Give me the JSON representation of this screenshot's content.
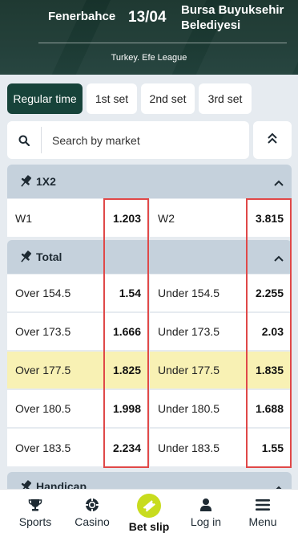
{
  "match": {
    "team1": "Fenerbahce",
    "score": "13/04",
    "team2": "Bursa Buyuksehir Belediyesi",
    "league": "Turkey. Efe League"
  },
  "tabs": [
    {
      "label": "Regular time",
      "active": true
    },
    {
      "label": "1st set",
      "active": false
    },
    {
      "label": "2nd set",
      "active": false
    },
    {
      "label": "3rd set",
      "active": false
    }
  ],
  "search": {
    "placeholder": "Search by market",
    "icon": "search-icon"
  },
  "collapse_icon": "double-chevron-up-icon",
  "markets": [
    {
      "title": "1X2",
      "rows": [
        {
          "left_label": "W1",
          "left_odd": "1.203",
          "right_label": "W2",
          "right_odd": "3.815",
          "highlighted": false
        }
      ]
    },
    {
      "title": "Total",
      "rows": [
        {
          "left_label": "Over 154.5",
          "left_odd": "1.54",
          "right_label": "Under 154.5",
          "right_odd": "2.255",
          "highlighted": false
        },
        {
          "left_label": "Over 173.5",
          "left_odd": "1.666",
          "right_label": "Under 173.5",
          "right_odd": "2.03",
          "highlighted": false
        },
        {
          "left_label": "Over 177.5",
          "left_odd": "1.825",
          "right_label": "Under 177.5",
          "right_odd": "1.835",
          "highlighted": true
        },
        {
          "left_label": "Over 180.5",
          "left_odd": "1.998",
          "right_label": "Under 180.5",
          "right_odd": "1.688",
          "highlighted": false
        },
        {
          "left_label": "Over 183.5",
          "left_odd": "2.234",
          "right_label": "Under 183.5",
          "right_odd": "1.55",
          "highlighted": false
        }
      ]
    },
    {
      "title": "Handicap",
      "rows": []
    }
  ],
  "nav": [
    {
      "label": "Sports",
      "icon": "trophy-icon"
    },
    {
      "label": "Casino",
      "icon": "casino-chip-icon"
    },
    {
      "label": "Bet slip",
      "icon": "ticket-icon"
    },
    {
      "label": "Log in",
      "icon": "user-icon"
    },
    {
      "label": "Menu",
      "icon": "menu-icon"
    }
  ],
  "colors": {
    "header_bg": "#17322b",
    "active_tab": "#17433a",
    "section_header": "#c5d1dc",
    "highlight_row": "#f8f1b4",
    "annotation_box": "#e04848",
    "bet_slip_accent": "#c8dc1e"
  }
}
